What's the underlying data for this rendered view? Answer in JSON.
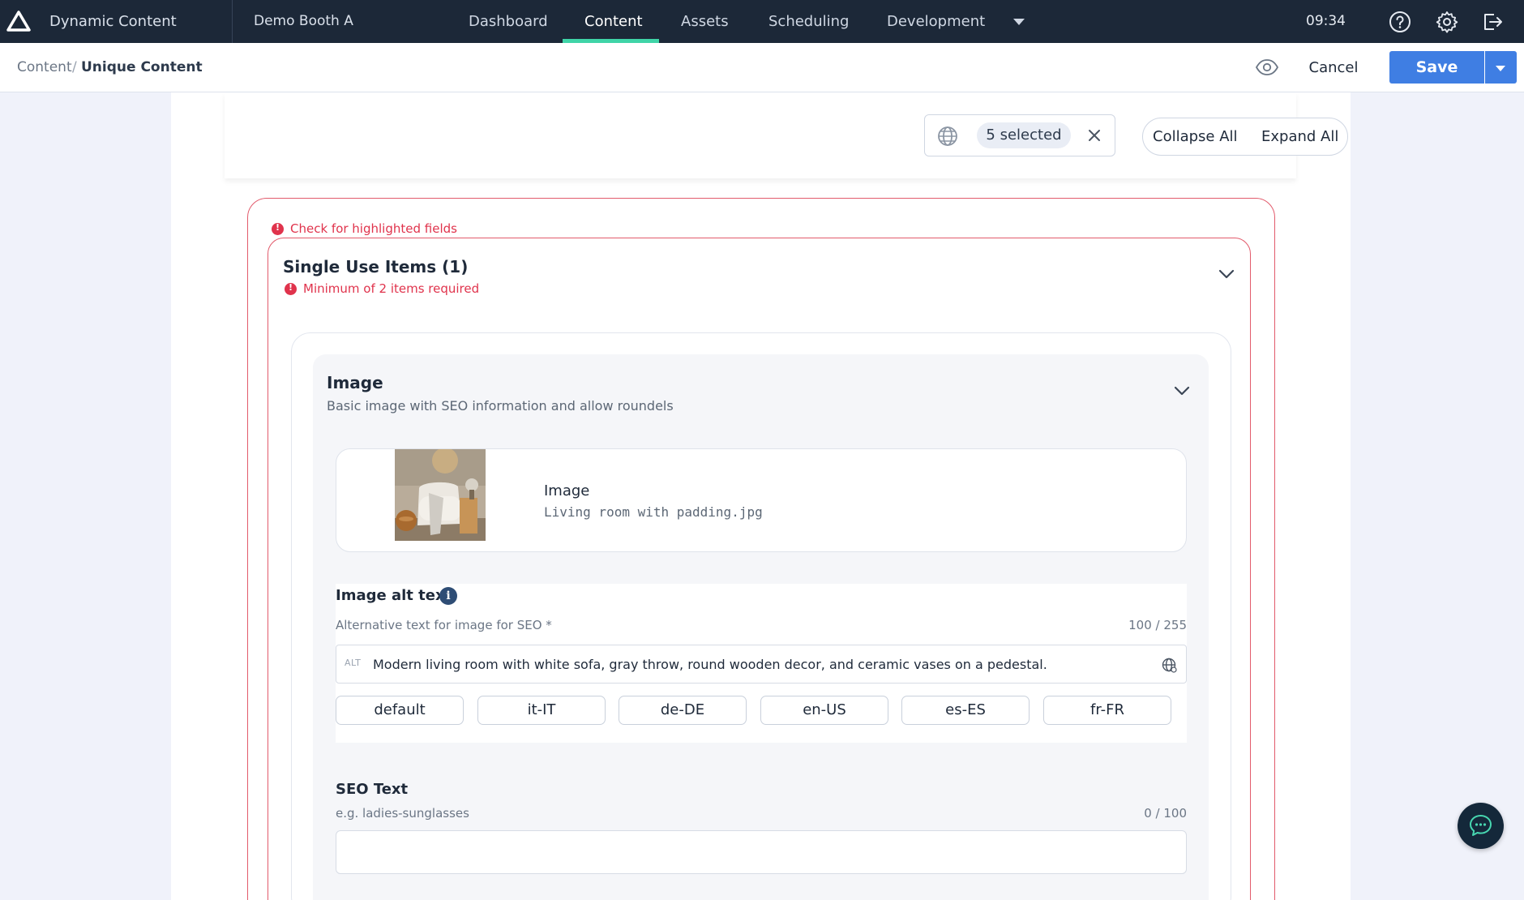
{
  "topbar": {
    "app_title": "Dynamic Content",
    "hub_name": "Demo Booth A",
    "nav": [
      {
        "label": "Dashboard",
        "active": false
      },
      {
        "label": "Content",
        "active": true
      },
      {
        "label": "Assets",
        "active": false
      },
      {
        "label": "Scheduling",
        "active": false
      },
      {
        "label": "Development",
        "active": false
      }
    ],
    "time": "09:34",
    "icons": [
      "help-icon",
      "settings-icon",
      "logout-icon"
    ],
    "accent_color": "#3fd4a7"
  },
  "subbar": {
    "breadcrumb": [
      "Content",
      "Unique Content"
    ],
    "breadcrumb_separator": "/",
    "cancel_label": "Cancel",
    "save_label": "Save",
    "save_color": "#3f7ee3"
  },
  "toolbar": {
    "locale_selected": "5 selected",
    "collapse_all": "Collapse All",
    "expand_all": "Expand All"
  },
  "validation": {
    "form_error": "Check for highlighted fields",
    "section_error": "Minimum of 2 items required",
    "error_color": "#e0334c"
  },
  "section": {
    "title": "Single Use Items (1)"
  },
  "item": {
    "title": "Image",
    "description": "Basic image with SEO information and allow roundels",
    "image": {
      "label": "Image",
      "filename": "Living room with padding.jpg"
    },
    "alt_text": {
      "title": "Image alt text",
      "help": "Alternative text for image for SEO *",
      "counter": "100 / 255",
      "prefix": "ALT",
      "value": "Modern living room with white sofa, gray throw, round wooden decor, and ceramic vases on a pedestal.",
      "locales": [
        "default",
        "it-IT",
        "de-DE",
        "en-US",
        "es-ES",
        "fr-FR"
      ]
    },
    "seo_text": {
      "title": "SEO Text",
      "placeholder_help": "e.g. ladies-sunglasses",
      "counter": "0 / 100",
      "value": ""
    }
  }
}
